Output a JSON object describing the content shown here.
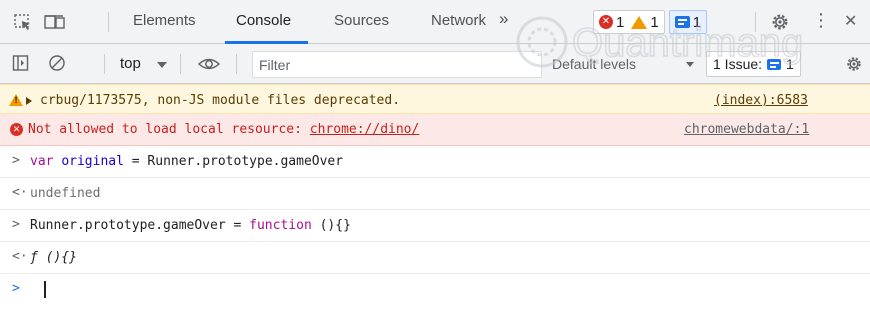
{
  "tabs": {
    "items": [
      {
        "label": "Elements"
      },
      {
        "label": "Console"
      },
      {
        "label": "Sources"
      },
      {
        "label": "Network"
      }
    ],
    "more": "»",
    "counters": {
      "errors": "1",
      "warnings": "1",
      "messages": "1"
    },
    "more_menu": "⋮",
    "close": "✕"
  },
  "toolbar": {
    "context": "top",
    "filter_placeholder": "Filter",
    "levels": "Default levels",
    "issues_prefix": "1 Issue:",
    "issues_count": "1"
  },
  "messages": {
    "warning": {
      "text": "crbug/1173575, non-JS module files deprecated.",
      "source": "(index):6583"
    },
    "error": {
      "text": "Not allowed to load local resource:",
      "url": "chrome://dino/",
      "source": "chromewebdata/:1"
    },
    "line1": {
      "kw": "var",
      "name": "original",
      "rest": " = Runner.prototype.gameOver"
    },
    "result1": "undefined",
    "line2": {
      "lhs": "Runner.prototype.gameOver = ",
      "kw": "function",
      "rest": " (){}"
    },
    "result2": "ƒ (){}"
  },
  "watermark": "Quantrimang",
  "colors": {
    "accent": "#1a73e8",
    "error": "#d93025",
    "warning": "#f29900",
    "keyword": "#aa0d91"
  }
}
